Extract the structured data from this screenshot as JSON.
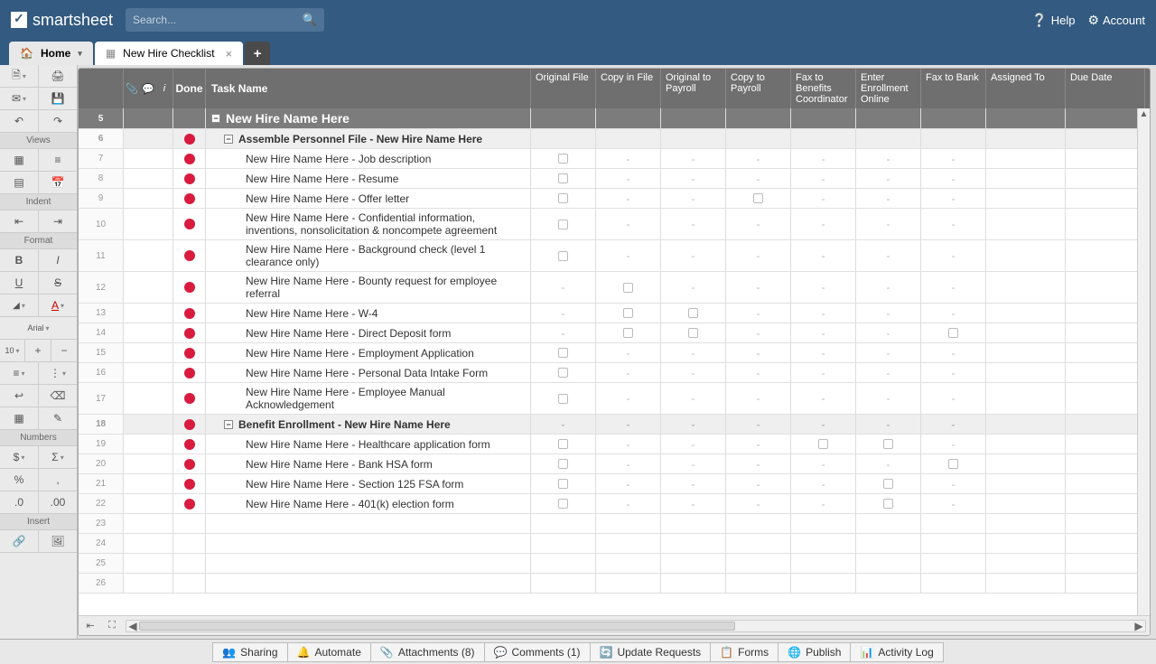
{
  "brand": "smartsheet",
  "search": {
    "placeholder": "Search..."
  },
  "header_links": {
    "help": "Help",
    "account": "Account"
  },
  "tabs": {
    "home": "Home",
    "file": "New Hire Checklist",
    "add": "+"
  },
  "sidebar": {
    "views": "Views",
    "indent": "Indent",
    "format": "Format",
    "font": "Arial",
    "size": "10",
    "numbers": "Numbers",
    "insert": "Insert"
  },
  "columns": {
    "done": "Done",
    "task": "Task Name",
    "c1": "Original File",
    "c2": "Copy in File",
    "c3": "Original to Payroll",
    "c4": "Copy to Payroll",
    "c5": "Fax to Benefits Coordinator",
    "c6": "Enter Enrollment Online",
    "c7": "Fax to Bank",
    "c8": "Assigned To",
    "c9": "Due Date"
  },
  "rows": [
    {
      "num": "5",
      "type": "header",
      "task": "New Hire Name Here",
      "cells": [
        "",
        "",
        "",
        "",
        "",
        "",
        "",
        "",
        ""
      ]
    },
    {
      "num": "6",
      "type": "section",
      "dot": true,
      "task": "Assemble Personnel File - New Hire Name Here",
      "cells": [
        "",
        "",
        "",
        "",
        "",
        "",
        "",
        "",
        ""
      ]
    },
    {
      "num": "7",
      "dot": true,
      "task": "New Hire Name Here - Job description",
      "cells": [
        "chk",
        "-",
        "-",
        "-",
        "-",
        "-",
        "-",
        "",
        ""
      ]
    },
    {
      "num": "8",
      "dot": true,
      "task": "New Hire Name Here - Resume",
      "cells": [
        "chk",
        "-",
        "-",
        "-",
        "-",
        "-",
        "-",
        "",
        ""
      ]
    },
    {
      "num": "9",
      "dot": true,
      "task": "New Hire Name Here - Offer letter",
      "cells": [
        "chk",
        "-",
        "-",
        "chk",
        "-",
        "-",
        "-",
        "",
        ""
      ]
    },
    {
      "num": "10",
      "dot": true,
      "task": "New Hire Name Here - Confidential information, inventions, nonsolicitation & noncompete agreement",
      "cells": [
        "chk",
        "-",
        "-",
        "-",
        "-",
        "-",
        "-",
        "",
        ""
      ]
    },
    {
      "num": "11",
      "dot": true,
      "task": "New Hire Name Here - Background check (level 1 clearance only)",
      "cells": [
        "chk",
        "-",
        "-",
        "-",
        "-",
        "-",
        "-",
        "",
        ""
      ]
    },
    {
      "num": "12",
      "dot": true,
      "task": "New Hire Name Here - Bounty request for employee referral",
      "cells": [
        "-",
        "chk",
        "-",
        "-",
        "-",
        "-",
        "-",
        "",
        ""
      ]
    },
    {
      "num": "13",
      "dot": true,
      "task": "New Hire Name Here - W-4",
      "cells": [
        "-",
        "chk",
        "chk",
        "-",
        "-",
        "-",
        "-",
        "",
        ""
      ]
    },
    {
      "num": "14",
      "dot": true,
      "task": "New Hire Name Here - Direct Deposit form",
      "cells": [
        "-",
        "chk",
        "chk",
        "-",
        "-",
        "-",
        "chk",
        "",
        ""
      ]
    },
    {
      "num": "15",
      "dot": true,
      "task": "New Hire Name Here - Employment Application",
      "cells": [
        "chk",
        "-",
        "-",
        "-",
        "-",
        "-",
        "-",
        "",
        ""
      ]
    },
    {
      "num": "16",
      "dot": true,
      "task": "New Hire Name Here - Personal Data Intake Form",
      "cells": [
        "chk",
        "-",
        "-",
        "-",
        "-",
        "-",
        "-",
        "",
        ""
      ]
    },
    {
      "num": "17",
      "dot": true,
      "task": "New Hire Name Here - Employee Manual Acknowledgement",
      "cells": [
        "chk",
        "-",
        "-",
        "-",
        "-",
        "-",
        "-",
        "",
        ""
      ]
    },
    {
      "num": "18",
      "type": "section",
      "dot": true,
      "task": "Benefit Enrollment - New Hire Name Here",
      "cells": [
        "-",
        "-",
        "-",
        "-",
        "-",
        "-",
        "-",
        "",
        ""
      ]
    },
    {
      "num": "19",
      "dot": true,
      "task": "New Hire Name Here - Healthcare application form",
      "cells": [
        "chk",
        "-",
        "-",
        "-",
        "chk",
        "chk",
        "-",
        "",
        ""
      ]
    },
    {
      "num": "20",
      "dot": true,
      "task": "New Hire Name Here - Bank HSA form",
      "cells": [
        "chk",
        "-",
        "-",
        "-",
        "-",
        "-",
        "chk",
        "",
        ""
      ]
    },
    {
      "num": "21",
      "dot": true,
      "task": "New Hire Name Here - Section 125 FSA form",
      "cells": [
        "chk",
        "-",
        "-",
        "-",
        "-",
        "chk",
        "-",
        "",
        ""
      ]
    },
    {
      "num": "22",
      "dot": true,
      "task": "New Hire Name Here - 401(k) election form",
      "cells": [
        "chk",
        "-",
        "-",
        "-",
        "-",
        "chk",
        "-",
        "",
        ""
      ]
    },
    {
      "num": "23",
      "cells": [
        "",
        "",
        "",
        "",
        "",
        "",
        "",
        "",
        ""
      ]
    },
    {
      "num": "24",
      "cells": [
        "",
        "",
        "",
        "",
        "",
        "",
        "",
        "",
        ""
      ]
    },
    {
      "num": "25",
      "cells": [
        "",
        "",
        "",
        "",
        "",
        "",
        "",
        "",
        ""
      ]
    },
    {
      "num": "26",
      "cells": [
        "",
        "",
        "",
        "",
        "",
        "",
        "",
        "",
        ""
      ]
    }
  ],
  "bottom": {
    "sharing": "Sharing",
    "automate": "Automate",
    "attachments": "Attachments (8)",
    "comments": "Comments (1)",
    "updates": "Update Requests",
    "forms": "Forms",
    "publish": "Publish",
    "activity": "Activity Log"
  }
}
